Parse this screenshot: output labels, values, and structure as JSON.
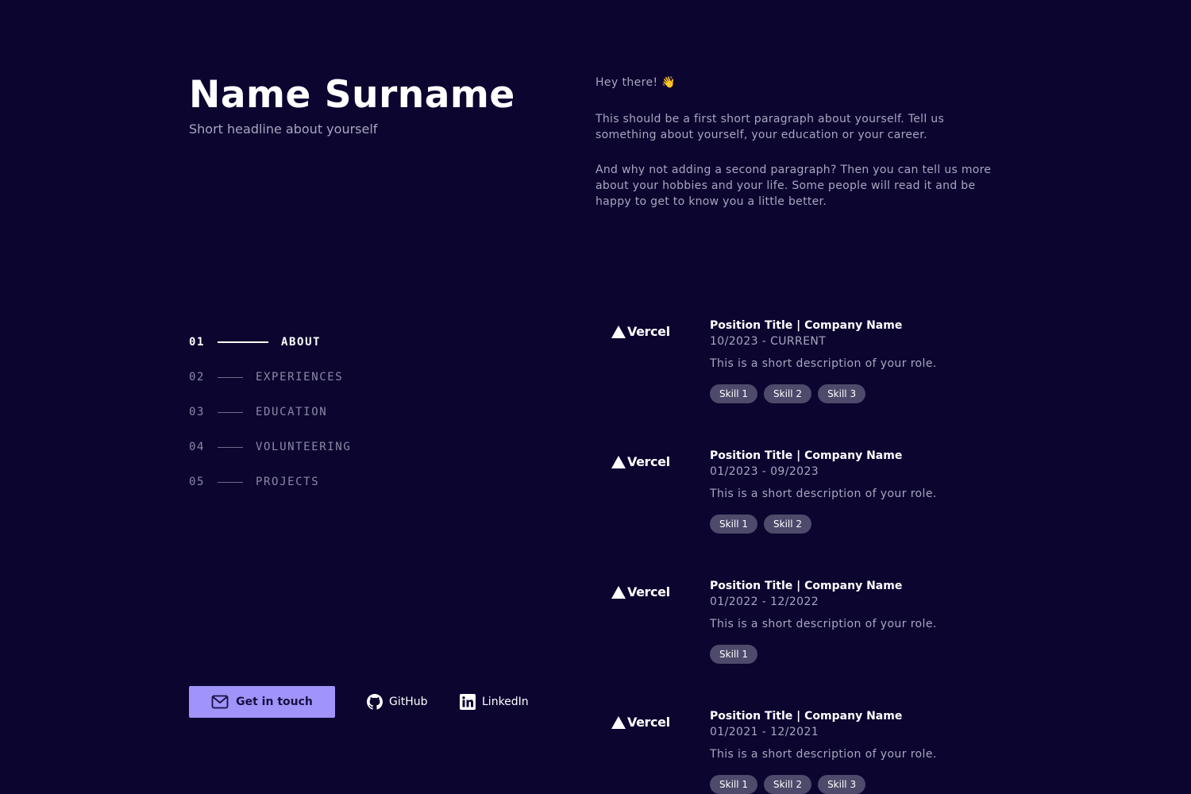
{
  "header": {
    "name": "Name Surname",
    "headline": "Short headline about yourself"
  },
  "nav": {
    "items": [
      {
        "num": "01",
        "label": "ABOUT",
        "active": true
      },
      {
        "num": "02",
        "label": "EXPERIENCES",
        "active": false
      },
      {
        "num": "03",
        "label": "EDUCATION",
        "active": false
      },
      {
        "num": "04",
        "label": "VOLUNTEERING",
        "active": false
      },
      {
        "num": "05",
        "label": "PROJECTS",
        "active": false
      }
    ]
  },
  "contact": {
    "button_label": "Get in touch",
    "button_icon": "mail-icon",
    "github_label": "GitHub",
    "github_icon": "github-icon",
    "linkedin_label": "LinkedIn",
    "linkedin_icon": "linkedin-icon"
  },
  "about": {
    "greeting": "Hey there! 👋",
    "paragraph_1": "This should be a first short paragraph about yourself. Tell us something about yourself, your education or your career.",
    "paragraph_2": "And why not adding a second paragraph? Then you can tell us more about your hobbies and your life. Some people will read it and be happy to get to know you a little better."
  },
  "experiences": [
    {
      "logo": "Vercel",
      "title": "Position Title | Company Name",
      "date": "10/2023 - CURRENT",
      "description": "This is a short description of your role.",
      "skills": [
        "Skill 1",
        "Skill 2",
        "Skill 3"
      ]
    },
    {
      "logo": "Vercel",
      "title": "Position Title | Company Name",
      "date": "01/2023 - 09/2023",
      "description": "This is a short description of your role.",
      "skills": [
        "Skill 1",
        "Skill 2"
      ]
    },
    {
      "logo": "Vercel",
      "title": "Position Title | Company Name",
      "date": "01/2022 - 12/2022",
      "description": "This is a short description of your role.",
      "skills": [
        "Skill 1"
      ]
    },
    {
      "logo": "Vercel",
      "title": "Position Title | Company Name",
      "date": "01/2021 - 12/2021",
      "description": "This is a short description of your role.",
      "skills": [
        "Skill 1",
        "Skill 2",
        "Skill 3"
      ]
    }
  ],
  "colors": {
    "background": "#0b0530",
    "accent": "#a093fa",
    "muted_text": "#a8a6bf",
    "skill_badge": "#4d4a6b"
  }
}
